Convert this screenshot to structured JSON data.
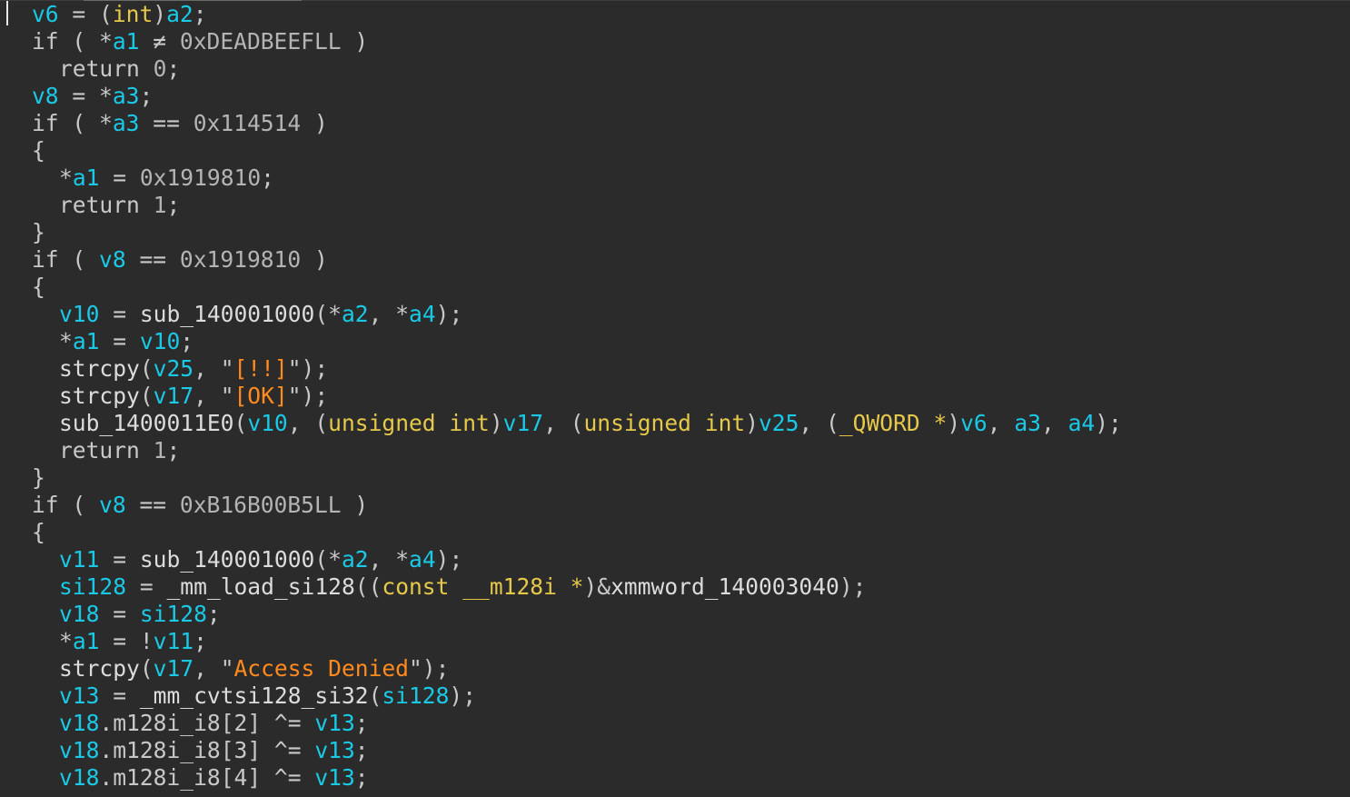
{
  "theme": {
    "background": "#2b2b2b",
    "variable": "#19c9e6",
    "keyword": "#c8c8c8",
    "plain": "#dcdcdc",
    "number": "#b4b4b4",
    "type": "#e6c84a",
    "string": "#ff8a1e"
  },
  "code_lines": [
    {
      "indent": 0,
      "tokens": [
        [
          "var",
          "v6"
        ],
        [
          "punct",
          " = ("
        ],
        [
          "type",
          "int"
        ],
        [
          "punct",
          ")"
        ],
        [
          "var",
          "a2"
        ],
        [
          "punct",
          ";"
        ]
      ]
    },
    {
      "indent": 0,
      "tokens": [
        [
          "kw",
          "if"
        ],
        [
          "punct",
          " ( *"
        ],
        [
          "var",
          "a1"
        ],
        [
          "punct",
          " ≠ "
        ],
        [
          "num",
          "0xDEADBEEFLL"
        ],
        [
          "punct",
          " )"
        ]
      ]
    },
    {
      "indent": 1,
      "tokens": [
        [
          "kw",
          "return"
        ],
        [
          "punct",
          " "
        ],
        [
          "num",
          "0"
        ],
        [
          "punct",
          ";"
        ]
      ]
    },
    {
      "indent": 0,
      "tokens": [
        [
          "var",
          "v8"
        ],
        [
          "punct",
          " = *"
        ],
        [
          "var",
          "a3"
        ],
        [
          "punct",
          ";"
        ]
      ]
    },
    {
      "indent": 0,
      "tokens": [
        [
          "kw",
          "if"
        ],
        [
          "punct",
          " ( *"
        ],
        [
          "var",
          "a3"
        ],
        [
          "punct",
          " == "
        ],
        [
          "num",
          "0x114514"
        ],
        [
          "punct",
          " )"
        ]
      ]
    },
    {
      "indent": 0,
      "tokens": [
        [
          "punct",
          "{"
        ]
      ]
    },
    {
      "indent": 1,
      "tokens": [
        [
          "punct",
          "*"
        ],
        [
          "var",
          "a1"
        ],
        [
          "punct",
          " = "
        ],
        [
          "num",
          "0x1919810"
        ],
        [
          "punct",
          ";"
        ]
      ]
    },
    {
      "indent": 1,
      "tokens": [
        [
          "kw",
          "return"
        ],
        [
          "punct",
          " "
        ],
        [
          "num",
          "1"
        ],
        [
          "punct",
          ";"
        ]
      ]
    },
    {
      "indent": 0,
      "tokens": [
        [
          "punct",
          "}"
        ]
      ]
    },
    {
      "indent": 0,
      "tokens": [
        [
          "kw",
          "if"
        ],
        [
          "punct",
          " ( "
        ],
        [
          "var",
          "v8"
        ],
        [
          "punct",
          " == "
        ],
        [
          "num",
          "0x1919810"
        ],
        [
          "punct",
          " )"
        ]
      ]
    },
    {
      "indent": 0,
      "tokens": [
        [
          "punct",
          "{"
        ]
      ]
    },
    {
      "indent": 1,
      "tokens": [
        [
          "var",
          "v10"
        ],
        [
          "punct",
          " = "
        ],
        [
          "plain",
          "sub_140001000"
        ],
        [
          "punct",
          "(*"
        ],
        [
          "var",
          "a2"
        ],
        [
          "punct",
          ", *"
        ],
        [
          "var",
          "a4"
        ],
        [
          "punct",
          ");"
        ]
      ]
    },
    {
      "indent": 1,
      "tokens": [
        [
          "punct",
          "*"
        ],
        [
          "var",
          "a1"
        ],
        [
          "punct",
          " = "
        ],
        [
          "var",
          "v10"
        ],
        [
          "punct",
          ";"
        ]
      ]
    },
    {
      "indent": 1,
      "tokens": [
        [
          "plain",
          "strcpy"
        ],
        [
          "punct",
          "("
        ],
        [
          "var",
          "v25"
        ],
        [
          "punct",
          ", \""
        ],
        [
          "str",
          "[!!]"
        ],
        [
          "punct",
          "\");"
        ]
      ]
    },
    {
      "indent": 1,
      "tokens": [
        [
          "plain",
          "strcpy"
        ],
        [
          "punct",
          "("
        ],
        [
          "var",
          "v17"
        ],
        [
          "punct",
          ", \""
        ],
        [
          "str",
          "[OK]"
        ],
        [
          "punct",
          "\");"
        ]
      ]
    },
    {
      "indent": 1,
      "tokens": [
        [
          "plain",
          "sub_1400011E0"
        ],
        [
          "punct",
          "("
        ],
        [
          "var",
          "v10"
        ],
        [
          "punct",
          ", ("
        ],
        [
          "type",
          "unsigned int"
        ],
        [
          "punct",
          ")"
        ],
        [
          "var",
          "v17"
        ],
        [
          "punct",
          ", ("
        ],
        [
          "type",
          "unsigned int"
        ],
        [
          "punct",
          ")"
        ],
        [
          "var",
          "v25"
        ],
        [
          "punct",
          ", ("
        ],
        [
          "type",
          "_QWORD *"
        ],
        [
          "punct",
          ")"
        ],
        [
          "var",
          "v6"
        ],
        [
          "punct",
          ", "
        ],
        [
          "var",
          "a3"
        ],
        [
          "punct",
          ", "
        ],
        [
          "var",
          "a4"
        ],
        [
          "punct",
          ");"
        ]
      ]
    },
    {
      "indent": 1,
      "tokens": [
        [
          "kw",
          "return"
        ],
        [
          "punct",
          " "
        ],
        [
          "num",
          "1"
        ],
        [
          "punct",
          ";"
        ]
      ]
    },
    {
      "indent": 0,
      "tokens": [
        [
          "punct",
          "}"
        ]
      ]
    },
    {
      "indent": 0,
      "tokens": [
        [
          "kw",
          "if"
        ],
        [
          "punct",
          " ( "
        ],
        [
          "var",
          "v8"
        ],
        [
          "punct",
          " == "
        ],
        [
          "num",
          "0xB16B00B5LL"
        ],
        [
          "punct",
          " )"
        ]
      ]
    },
    {
      "indent": 0,
      "tokens": [
        [
          "punct",
          "{"
        ]
      ]
    },
    {
      "indent": 1,
      "tokens": [
        [
          "var",
          "v11"
        ],
        [
          "punct",
          " = "
        ],
        [
          "plain",
          "sub_140001000"
        ],
        [
          "punct",
          "(*"
        ],
        [
          "var",
          "a2"
        ],
        [
          "punct",
          ", *"
        ],
        [
          "var",
          "a4"
        ],
        [
          "punct",
          ");"
        ]
      ]
    },
    {
      "indent": 1,
      "tokens": [
        [
          "var",
          "si128"
        ],
        [
          "punct",
          " = "
        ],
        [
          "plain",
          "_mm_load_si128"
        ],
        [
          "punct",
          "(("
        ],
        [
          "type",
          "const __m128i *"
        ],
        [
          "punct",
          ")&"
        ],
        [
          "plain",
          "xmmword_140003040"
        ],
        [
          "punct",
          ");"
        ]
      ]
    },
    {
      "indent": 1,
      "tokens": [
        [
          "var",
          "v18"
        ],
        [
          "punct",
          " = "
        ],
        [
          "var",
          "si128"
        ],
        [
          "punct",
          ";"
        ]
      ]
    },
    {
      "indent": 1,
      "tokens": [
        [
          "punct",
          "*"
        ],
        [
          "var",
          "a1"
        ],
        [
          "punct",
          " = !"
        ],
        [
          "var",
          "v11"
        ],
        [
          "punct",
          ";"
        ]
      ]
    },
    {
      "indent": 1,
      "tokens": [
        [
          "plain",
          "strcpy"
        ],
        [
          "punct",
          "("
        ],
        [
          "var",
          "v17"
        ],
        [
          "punct",
          ", \""
        ],
        [
          "str",
          "Access Denied"
        ],
        [
          "punct",
          "\");"
        ]
      ]
    },
    {
      "indent": 1,
      "tokens": [
        [
          "var",
          "v13"
        ],
        [
          "punct",
          " = "
        ],
        [
          "plain",
          "_mm_cvtsi128_si32"
        ],
        [
          "punct",
          "("
        ],
        [
          "var",
          "si128"
        ],
        [
          "punct",
          ");"
        ]
      ]
    },
    {
      "indent": 1,
      "tokens": [
        [
          "var",
          "v18"
        ],
        [
          "punct",
          "."
        ],
        [
          "kw",
          "m128i_i8"
        ],
        [
          "punct",
          "[2] ^= "
        ],
        [
          "var",
          "v13"
        ],
        [
          "punct",
          ";"
        ]
      ]
    },
    {
      "indent": 1,
      "tokens": [
        [
          "var",
          "v18"
        ],
        [
          "punct",
          "."
        ],
        [
          "kw",
          "m128i_i8"
        ],
        [
          "punct",
          "[3] ^= "
        ],
        [
          "var",
          "v13"
        ],
        [
          "punct",
          ";"
        ]
      ]
    },
    {
      "indent": 1,
      "tokens": [
        [
          "var",
          "v18"
        ],
        [
          "punct",
          "."
        ],
        [
          "kw",
          "m128i_i8"
        ],
        [
          "punct",
          "[4] ^= "
        ],
        [
          "var",
          "v13"
        ],
        [
          "punct",
          ";"
        ]
      ]
    }
  ]
}
